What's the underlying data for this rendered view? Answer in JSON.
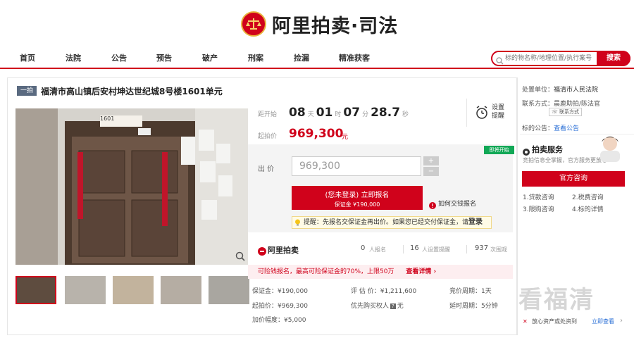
{
  "header": {
    "logo_text": "阿里拍卖·司法"
  },
  "nav": {
    "items": [
      "首页",
      "法院",
      "公告",
      "预告",
      "破产",
      "刑案",
      "捡漏",
      "精准获客"
    ]
  },
  "search": {
    "placeholder": "标的物名称/地理位置/执行案号",
    "button": "搜索"
  },
  "item": {
    "round_tag": "一拍",
    "title": "福清市高山镇后安村坤达世纪城8号楼1601单元",
    "door_sign": "1601"
  },
  "countdown": {
    "label": "距开始",
    "days": "08",
    "days_unit": "天",
    "hours": "01",
    "hours_unit": "时",
    "minutes": "07",
    "minutes_unit": "分",
    "seconds": "28.7",
    "seconds_unit": "秒",
    "reminder_label_1": "设置",
    "reminder_label_2": "提醒"
  },
  "price": {
    "start_label": "起拍价",
    "start_value": "969,300",
    "unit": "元",
    "status_tag": "即将开始",
    "bid_label": "出 价",
    "bid_value": "969,300"
  },
  "signup": {
    "line1": "(您未登录) 立即报名",
    "line2": "保证金 ¥190,000",
    "help": "如何交钱报名"
  },
  "reminder_bar": {
    "text": "提醒：先报名交保证金再出价。如果您已经交付保证金，请",
    "link": "登录"
  },
  "stats": {
    "brand": "阿里拍卖",
    "signup_count": "0",
    "signup_label": "人报名",
    "reminder_count": "16",
    "reminder_label": "人设置提醒",
    "view_count": "937",
    "view_label": "次围观"
  },
  "tip_bar": {
    "text": "可险钱报名，最高可险保证金的70%，上限50万",
    "link": "查看详情 ›"
  },
  "details": [
    {
      "label": "保证金：",
      "value": "¥190,000"
    },
    {
      "label": "评 估 价：",
      "value": "¥1,211,600"
    },
    {
      "label": "竞价周期：",
      "value": "1天"
    },
    {
      "label": "起拍价：",
      "value": "¥969,300"
    },
    {
      "label": "优先购买权人",
      "value": "无"
    },
    {
      "label": "延时周期：",
      "value": "5分钟"
    },
    {
      "label": "加价幅度：",
      "value": "¥5,000"
    }
  ],
  "sidebar": {
    "court_label": "处置单位：",
    "court_value": "福清市人民法院",
    "contact_label": "联系方式：",
    "contact_value": "晨鹿助拍/陈法官",
    "contact_button": "联系方式",
    "notice_label": "标的公告：",
    "notice_link": "查看公告",
    "service_title": "拍卖服务",
    "service_sub": "竞拍信息全掌握，官方服务更放心",
    "consult_button": "官方咨询",
    "links": [
      "1.贷款咨询",
      "2.税费咨询",
      "3.限购咨询",
      "4.标的详情"
    ],
    "asset_text": "放心资产或处资到",
    "asset_link": "立即查看"
  },
  "watermark": "看福清"
}
